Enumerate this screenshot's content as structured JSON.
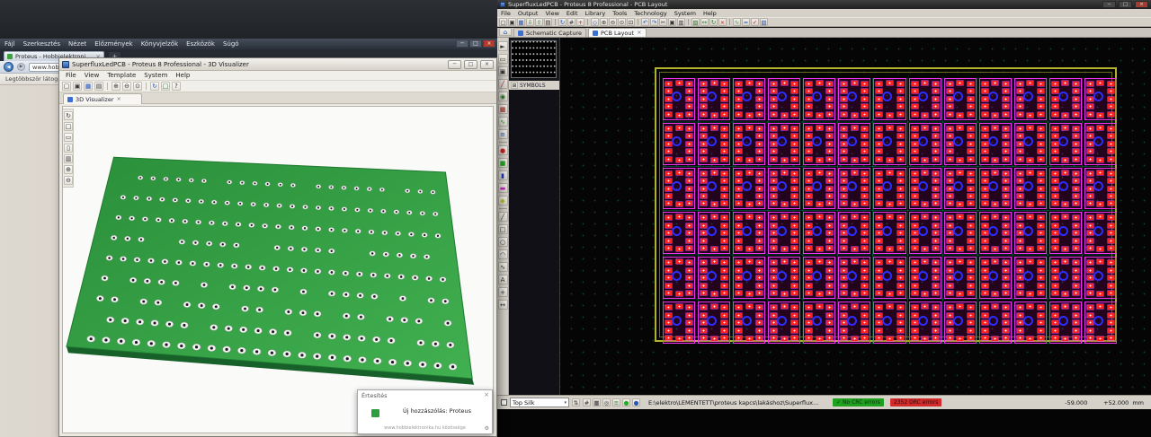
{
  "icons": {
    "minimize": "─",
    "maximize": "□",
    "close": "×",
    "close_tab": "×",
    "dropdown": "▾",
    "home": "⌂",
    "back": "◀",
    "forward": "▶",
    "reload": "↻",
    "star": "★",
    "gear": "⚙",
    "check": "✓",
    "new_tab": "+",
    "panel_grid": "⊞",
    "spinner": "⇅"
  },
  "browser": {
    "menu": [
      "Fájl",
      "Szerkesztés",
      "Nézet",
      "Előzmények",
      "Könyvjelzők",
      "Eszközök",
      "Súgó"
    ],
    "tab_title": "Proteus - Hobbielektronika...",
    "url": "www.hobbielektronika.hu",
    "bookmarks_label": "Legtöbbször látogatott"
  },
  "viewer3d": {
    "title": "SuperfluxLedPCB - Proteus 8 Professional - 3D Visualizer",
    "menu": [
      "File",
      "View",
      "Template",
      "System",
      "Help"
    ],
    "tab": "3D Visualizer",
    "toolbar": [
      {
        "n": "new",
        "g": "▢"
      },
      {
        "n": "open",
        "g": "▣"
      },
      {
        "n": "save",
        "g": "▦",
        "c": "#2255bb"
      },
      {
        "n": "print",
        "g": "▤"
      },
      {
        "sep": true
      },
      {
        "n": "zoom-in",
        "g": "⊕"
      },
      {
        "n": "zoom-out",
        "g": "⊖"
      },
      {
        "n": "zoom-all",
        "g": "⊙"
      },
      {
        "sep": true
      },
      {
        "n": "rotate-view",
        "g": "↻",
        "c": "#2255bb"
      },
      {
        "n": "top-view",
        "g": "□",
        "c": "#227722"
      },
      {
        "n": "help",
        "g": "?"
      }
    ],
    "side_tools": [
      {
        "n": "orbit",
        "g": "↻"
      },
      {
        "n": "top-view",
        "g": "□"
      },
      {
        "n": "front-view",
        "g": "▭"
      },
      {
        "n": "side-view",
        "g": "▯"
      },
      {
        "n": "bottom-view",
        "g": "▥"
      },
      {
        "n": "zoom-in",
        "g": "⊕"
      },
      {
        "n": "zoom-out",
        "g": "⊖"
      }
    ],
    "board": {
      "rows": 9,
      "cols": 25,
      "top_color_1": "#2a8f3a",
      "top_color_2": "#41b050",
      "edge_color": "#17602a",
      "pad_color": "#f2f2f2",
      "hole_color": "#1b1b1b"
    }
  },
  "notification": {
    "title": "Értesítés",
    "message": "Új hozzászólás: Proteus",
    "footer": "www.hobbielektronika.hu közössége"
  },
  "pcb": {
    "title": "SuperfluxLedPCB - Proteus 8 Professional - PCB Layout",
    "menu": [
      "File",
      "Output",
      "View",
      "Edit",
      "Library",
      "Tools",
      "Technology",
      "System",
      "Help"
    ],
    "tabs": [
      "Schematic Capture",
      "PCB Layout"
    ],
    "panel_label": "SYMBOLS",
    "toolbar": [
      {
        "n": "new-layout",
        "g": "▢"
      },
      {
        "n": "open-layout",
        "g": "▣"
      },
      {
        "n": "save-layout",
        "g": "▦",
        "c": "#2255bb"
      },
      {
        "n": "import",
        "g": "⇩",
        "c": "#336633"
      },
      {
        "n": "export",
        "g": "⇧",
        "c": "#336633"
      },
      {
        "n": "print",
        "g": "▤"
      },
      {
        "sep": true
      },
      {
        "n": "redraw",
        "g": "↻",
        "c": "#2255bb"
      },
      {
        "n": "grid-toggle",
        "g": "#"
      },
      {
        "n": "origin",
        "g": "+",
        "c": "#bb2222"
      },
      {
        "sep": true
      },
      {
        "n": "center-view",
        "g": "◇",
        "c": "#2255bb"
      },
      {
        "n": "zoom-in",
        "g": "⊕"
      },
      {
        "n": "zoom-out",
        "g": "⊖"
      },
      {
        "n": "zoom-all",
        "g": "⊙"
      },
      {
        "n": "zoom-area",
        "g": "⊡"
      },
      {
        "sep": true
      },
      {
        "n": "undo",
        "g": "↶",
        "c": "#2255bb"
      },
      {
        "n": "redo",
        "g": "↷",
        "c": "#2255bb"
      },
      {
        "n": "cut",
        "g": "✂"
      },
      {
        "n": "copy",
        "g": "▣"
      },
      {
        "n": "paste",
        "g": "▥"
      },
      {
        "sep": true
      },
      {
        "n": "block-copy",
        "g": "▨",
        "c": "#227722"
      },
      {
        "n": "block-move",
        "g": "↔",
        "c": "#227722"
      },
      {
        "n": "block-rotate",
        "g": "↻",
        "c": "#227722"
      },
      {
        "n": "block-delete",
        "g": "×",
        "c": "#bb2222"
      },
      {
        "sep": true
      },
      {
        "n": "ratsnest",
        "g": "∿",
        "c": "#22aa22"
      },
      {
        "n": "auto-route",
        "g": "≈",
        "c": "#2255bb"
      },
      {
        "n": "design-rule-check",
        "g": "✓",
        "c": "#bb2222"
      },
      {
        "n": "3d-view",
        "g": "▧",
        "c": "#2255bb"
      }
    ],
    "side_tools": [
      {
        "n": "selection-tool",
        "g": "►"
      },
      {
        "n": "component-tool",
        "g": "▭"
      },
      {
        "n": "package-tool",
        "g": "▣"
      },
      {
        "n": "track-tool",
        "g": "╱",
        "c": "#aa2222"
      },
      {
        "n": "via-tool",
        "g": "◉",
        "c": "#227722"
      },
      {
        "n": "zone-tool",
        "g": "▩",
        "c": "#aa2222"
      },
      {
        "n": "ratsnest-tool",
        "g": "∿",
        "c": "#22aa22"
      },
      {
        "n": "connectivity-tool",
        "g": "≡",
        "c": "#2255bb"
      },
      {
        "sep": true
      },
      {
        "n": "round-pad-tool",
        "g": "●",
        "c": "#cc2222"
      },
      {
        "n": "square-pad-tool",
        "g": "■",
        "c": "#22aa22"
      },
      {
        "n": "dil-pad-tool",
        "g": "▮",
        "c": "#2233cc"
      },
      {
        "n": "edge-pad-tool",
        "g": "▬",
        "c": "#cc22cc"
      },
      {
        "n": "smt-pad-tool",
        "g": "◆",
        "c": "#bbbb22"
      },
      {
        "sep": true
      },
      {
        "n": "line-tool",
        "g": "╱"
      },
      {
        "n": "box-tool",
        "g": "□"
      },
      {
        "n": "circle-tool",
        "g": "○"
      },
      {
        "n": "arc-tool",
        "g": "◠"
      },
      {
        "n": "path-tool",
        "g": "∿"
      },
      {
        "n": "text-tool",
        "g": "A"
      },
      {
        "n": "marker-tool",
        "g": "+"
      },
      {
        "n": "dimension-tool",
        "g": "↔"
      }
    ],
    "status_tools": [
      {
        "n": "snap-toggle",
        "g": "#"
      },
      {
        "n": "grid-units",
        "g": "▦"
      },
      {
        "n": "polar-coords",
        "g": "◎"
      },
      {
        "n": "trace-style",
        "g": "≡",
        "c": "#227722"
      },
      {
        "n": "live-netlist",
        "g": "●",
        "c": "#22aa22"
      },
      {
        "n": "auto-trace",
        "g": "●",
        "c": "#2255bb"
      }
    ],
    "grid": {
      "rows": 6,
      "cols": 13
    },
    "status": {
      "layer": "Top Silk",
      "path": "E:\\elektro\\LEMENTETT\\proteus kapcs\\lakáshoz\\SuperfluxLedPCB.pdsprj",
      "crc": "No CRC errors",
      "drc": "2352 DRC errors",
      "coord_x": "-59.000",
      "coord_y": "+52.000",
      "units": "mm"
    }
  }
}
